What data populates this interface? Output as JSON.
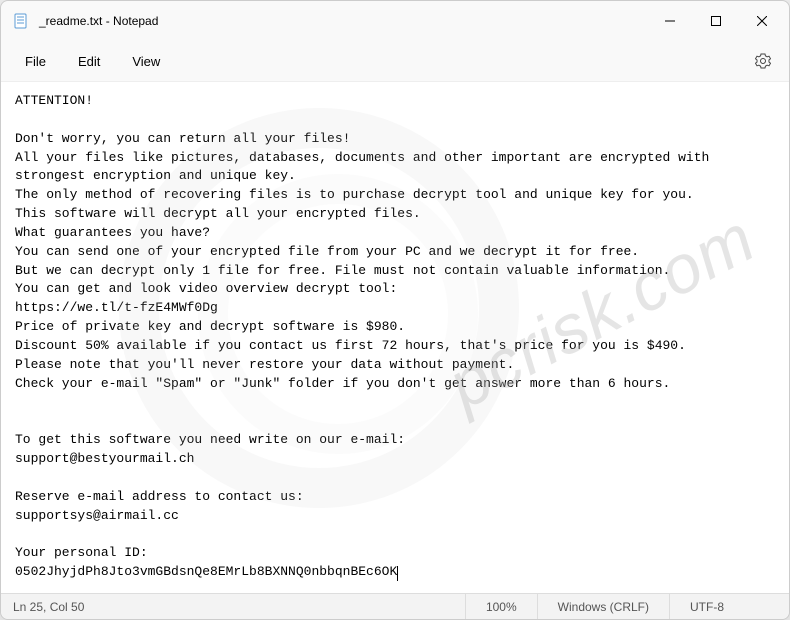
{
  "titlebar": {
    "title": "_readme.txt - Notepad"
  },
  "menubar": {
    "file": "File",
    "edit": "Edit",
    "view": "View"
  },
  "content": {
    "text": "ATTENTION!\n\nDon't worry, you can return all your files!\nAll your files like pictures, databases, documents and other important are encrypted with strongest encryption and unique key.\nThe only method of recovering files is to purchase decrypt tool and unique key for you.\nThis software will decrypt all your encrypted files.\nWhat guarantees you have?\nYou can send one of your encrypted file from your PC and we decrypt it for free.\nBut we can decrypt only 1 file for free. File must not contain valuable information.\nYou can get and look video overview decrypt tool:\nhttps://we.tl/t-fzE4MWf0Dg\nPrice of private key and decrypt software is $980.\nDiscount 50% available if you contact us first 72 hours, that's price for you is $490.\nPlease note that you'll never restore your data without payment.\nCheck your e-mail \"Spam\" or \"Junk\" folder if you don't get answer more than 6 hours.\n\n\nTo get this software you need write on our e-mail:\nsupport@bestyourmail.ch\n\nReserve e-mail address to contact us:\nsupportsys@airmail.cc\n\nYour personal ID:\n0502JhyjdPh8Jto3vmGBdsnQe8EMrLb8BXNNQ0nbbqnBEc6OK"
  },
  "statusbar": {
    "position": "Ln 25, Col 50",
    "zoom": "100%",
    "lineending": "Windows (CRLF)",
    "encoding": "UTF-8"
  },
  "watermark": "pcrisk.com"
}
